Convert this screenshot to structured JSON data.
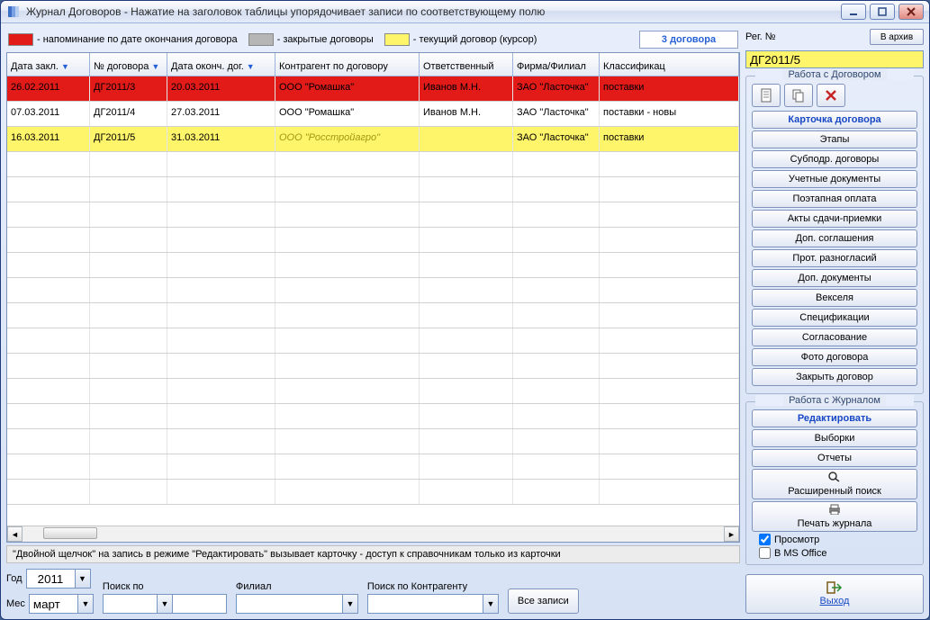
{
  "window": {
    "title": "Журнал Договоров   -   Нажатие на заголовок таблицы упорядочивает записи по соответствующему полю"
  },
  "legend": {
    "reminder": " - напоминание по дате окончания договора",
    "closed": " - закрытые договоры",
    "current": " - текущий договор (курсор)",
    "count": "3 договора"
  },
  "table": {
    "headers": [
      "Дата закл.",
      "№ договора",
      "Дата оконч. дог.",
      "Контрагент по договору",
      "Ответственный",
      "Фирма/Филиал",
      "Классификац"
    ],
    "rows": [
      {
        "state": "red",
        "cells": [
          "26.02.2011",
          "ДГ2011/3",
          "20.03.2011",
          "ООО \"Ромашка\"",
          "Иванов М.Н.",
          "ЗАО \"Ласточка\"",
          "поставки"
        ]
      },
      {
        "state": "normal",
        "cells": [
          "07.03.2011",
          "ДГ2011/4",
          "27.03.2011",
          "ООО \"Ромашка\"",
          "Иванов М.Н.",
          "ЗАО \"Ласточка\"",
          "поставки - новы"
        ]
      },
      {
        "state": "yellow",
        "cells": [
          "16.03.2011",
          "ДГ2011/5",
          "31.03.2011",
          "ООО \"Росстройагро\"",
          "",
          "ЗАО \"Ласточка\"",
          "поставки"
        ]
      }
    ],
    "hint": "\"Двойной щелчок\" на запись в режиме \"Редактировать\" вызывает карточку   -  доступ к справочникам только из карточки"
  },
  "filters": {
    "year_label": "Год",
    "year_value": "2011",
    "month_label": "Мес",
    "month_value": "март",
    "search_label": "Поиск по",
    "branch_label": "Филиал",
    "contragent_label": "Поиск по Контрагенту",
    "all_button": "Все записи"
  },
  "right": {
    "reg_label": "Рег. №",
    "archive": "В архив",
    "reg_value": "ДГ2011/5",
    "group_contract": "Работа с Договором",
    "contract_buttons": [
      "Карточка договора",
      "Этапы",
      "Субподр. договоры",
      "Учетные документы",
      "Поэтапная оплата",
      "Акты сдачи-приемки",
      "Доп. соглашения",
      "Прот. разногласий",
      "Доп. документы",
      "Векселя",
      "Спецификации",
      "Согласование",
      "Фото договора",
      "Закрыть договор"
    ],
    "group_journal": "Работа с Журналом",
    "journal_buttons": [
      "Редактировать",
      "Выборки",
      "Отчеты"
    ],
    "ext_search": "Расширенный поиск",
    "print": "Печать журнала",
    "chk_preview": "Просмотр",
    "chk_office": "В MS Office",
    "exit": "Выход"
  }
}
